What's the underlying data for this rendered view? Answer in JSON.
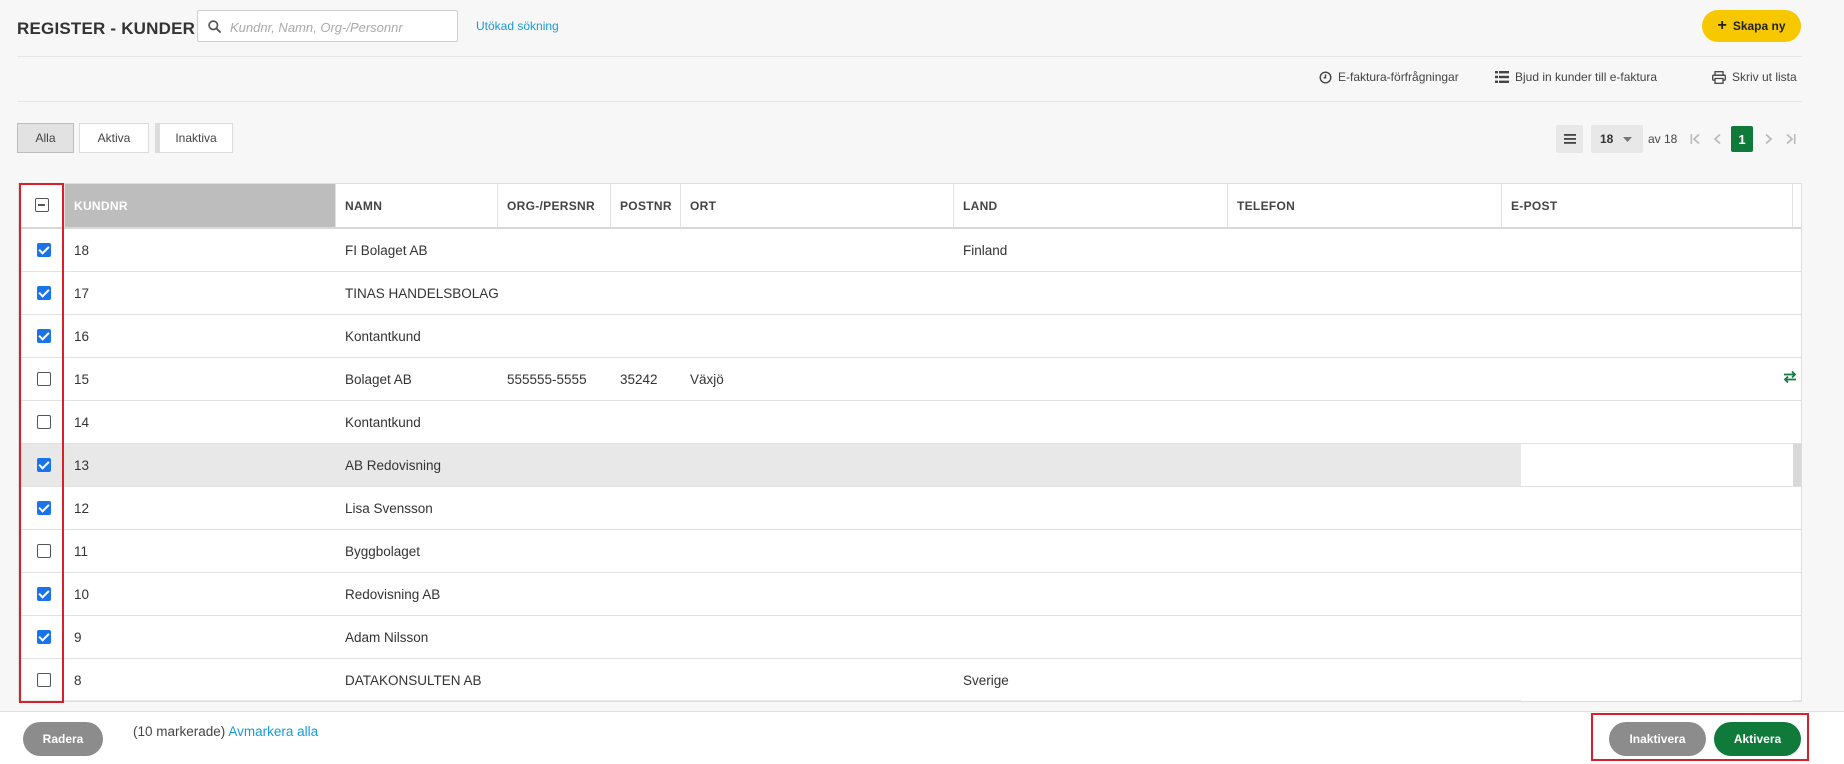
{
  "header": {
    "title": "REGISTER - KUNDER",
    "search_placeholder": "Kundnr, Namn, Org-/Personnr",
    "advanced_search": "Utökad sökning",
    "create_new": "Skapa ny"
  },
  "actions": {
    "einvoice_requests": "E-faktura-förfrågningar",
    "invite_einvoice": "Bjud in kunder till e-faktura",
    "print_list": "Skriv ut lista"
  },
  "filters": [
    "Alla",
    "Aktiva",
    "Inaktiva"
  ],
  "active_filter": "Alla",
  "pager": {
    "page_size": "18",
    "of_label": "av 18",
    "current_page": "1"
  },
  "table": {
    "columns": [
      "KUNDNR",
      "NAMN",
      "ORG-/PERSNR",
      "POSTNR",
      "ORT",
      "LAND",
      "TELEFON",
      "E-POST"
    ],
    "rows": [
      {
        "checked": true,
        "kundnr": "18",
        "namn": "FI Bolaget AB",
        "org": "",
        "postnr": "",
        "ort": "",
        "land": "Finland",
        "telefon": "",
        "epost": ""
      },
      {
        "checked": true,
        "kundnr": "17",
        "namn": "TINAS HANDELSBOLAG",
        "org": "",
        "postnr": "",
        "ort": "",
        "land": "",
        "telefon": "",
        "epost": ""
      },
      {
        "checked": true,
        "kundnr": "16",
        "namn": "Kontantkund",
        "org": "",
        "postnr": "",
        "ort": "",
        "land": "",
        "telefon": "",
        "epost": ""
      },
      {
        "checked": false,
        "kundnr": "15",
        "namn": "Bolaget AB",
        "org": "555555-5555",
        "postnr": "35242",
        "ort": "Växjö",
        "land": "",
        "telefon": "",
        "epost": ""
      },
      {
        "checked": false,
        "kundnr": "14",
        "namn": "Kontantkund",
        "org": "",
        "postnr": "",
        "ort": "",
        "land": "",
        "telefon": "",
        "epost": ""
      },
      {
        "checked": true,
        "kundnr": "13",
        "namn": "AB Redovisning",
        "org": "",
        "postnr": "",
        "ort": "",
        "land": "",
        "telefon": "",
        "epost": ""
      },
      {
        "checked": true,
        "kundnr": "12",
        "namn": "Lisa Svensson",
        "org": "",
        "postnr": "",
        "ort": "",
        "land": "",
        "telefon": "",
        "epost": ""
      },
      {
        "checked": false,
        "kundnr": "11",
        "namn": "Byggbolaget",
        "org": "",
        "postnr": "",
        "ort": "",
        "land": "",
        "telefon": "",
        "epost": ""
      },
      {
        "checked": true,
        "kundnr": "10",
        "namn": "Redovisning AB",
        "org": "",
        "postnr": "",
        "ort": "",
        "land": "",
        "telefon": "",
        "epost": ""
      },
      {
        "checked": true,
        "kundnr": "9",
        "namn": "Adam Nilsson",
        "org": "",
        "postnr": "",
        "ort": "",
        "land": "",
        "telefon": "",
        "epost": ""
      },
      {
        "checked": false,
        "kundnr": "8",
        "namn": "DATAKONSULTEN AB",
        "org": "",
        "postnr": "",
        "ort": "",
        "land": "Sverige",
        "telefon": "",
        "epost": ""
      }
    ]
  },
  "footer": {
    "delete": "Radera",
    "selected_count": "(10 markerade)",
    "deselect_all": "Avmarkera alla",
    "deactivate": "Inaktivera",
    "activate": "Aktivera"
  },
  "colors": {
    "accent_yellow": "#f7c800",
    "primary_green": "#0f7a3a",
    "link_blue": "#1a9ad6",
    "checkbox_blue": "#1a73e8",
    "highlight_red": "#d9202a"
  }
}
